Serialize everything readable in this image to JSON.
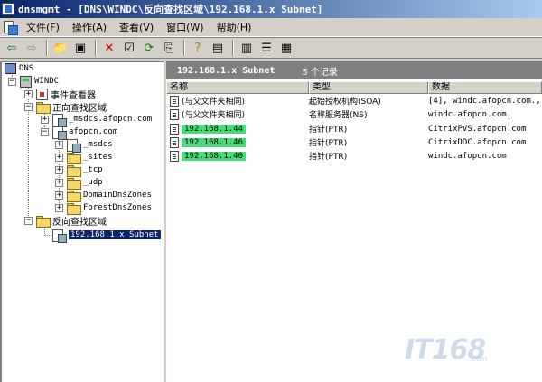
{
  "window": {
    "title": "dnsmgmt - [DNS\\WINDC\\反向查找区域\\192.168.1.x Subnet]"
  },
  "menu": [
    "文件(F)",
    "操作(A)",
    "查看(V)",
    "窗口(W)",
    "帮助(H)"
  ],
  "tree": {
    "root": "DNS",
    "server": "WINDC",
    "event_viewer": "事件查看器",
    "forward_zones": "正向查找区域",
    "msdcs_zone": "_msdcs.afopcn.com",
    "afopcn_zone": "afopcn.com",
    "children": [
      "_msdcs",
      "_sites",
      "_tcp",
      "_udp",
      "DomainDnsZones",
      "ForestDnsZones"
    ],
    "reverse_zones": "反向查找区域",
    "subnet": "192.168.1.x Subnet"
  },
  "pane": {
    "title": "192.168.1.x Subnet",
    "count": "5 个记录"
  },
  "columns": [
    "名称",
    "类型",
    "数据"
  ],
  "records": [
    {
      "name": "(与父文件夹相同)",
      "type": "起始授权机构(SOA)",
      "data": "[4], windc.afopcn.com., ...",
      "highlight": false
    },
    {
      "name": "(与父文件夹相同)",
      "type": "名称服务器(NS)",
      "data": "windc.afopcn.com.",
      "highlight": false
    },
    {
      "name": "192.168.1.44",
      "type": "指针(PTR)",
      "data": "CitrixPVS.afopcn.com",
      "highlight": true
    },
    {
      "name": "192.168.1.46",
      "type": "指针(PTR)",
      "data": "CitrixDDC.afopcn.com",
      "highlight": true
    },
    {
      "name": "192.168.1.40",
      "type": "指针(PTR)",
      "data": "windc.afopcn.com",
      "highlight": true
    }
  ],
  "toolbar_icons": [
    "back-arrow-icon",
    "forward-arrow-icon",
    "up-folder-icon",
    "show-hide-tree-icon",
    "delete-icon",
    "properties-icon",
    "refresh-icon",
    "export-list-icon",
    "help-icon",
    "console-tree-icon",
    "server-record-icon",
    "list-icon",
    "details-icon"
  ],
  "watermark": {
    "text": "IT168",
    "sub": ".com"
  },
  "colors": {
    "titlebar_start": "#0a246a",
    "titlebar_end": "#a6caf0",
    "highlight": "#44dd77",
    "selection": "#0a246a"
  }
}
